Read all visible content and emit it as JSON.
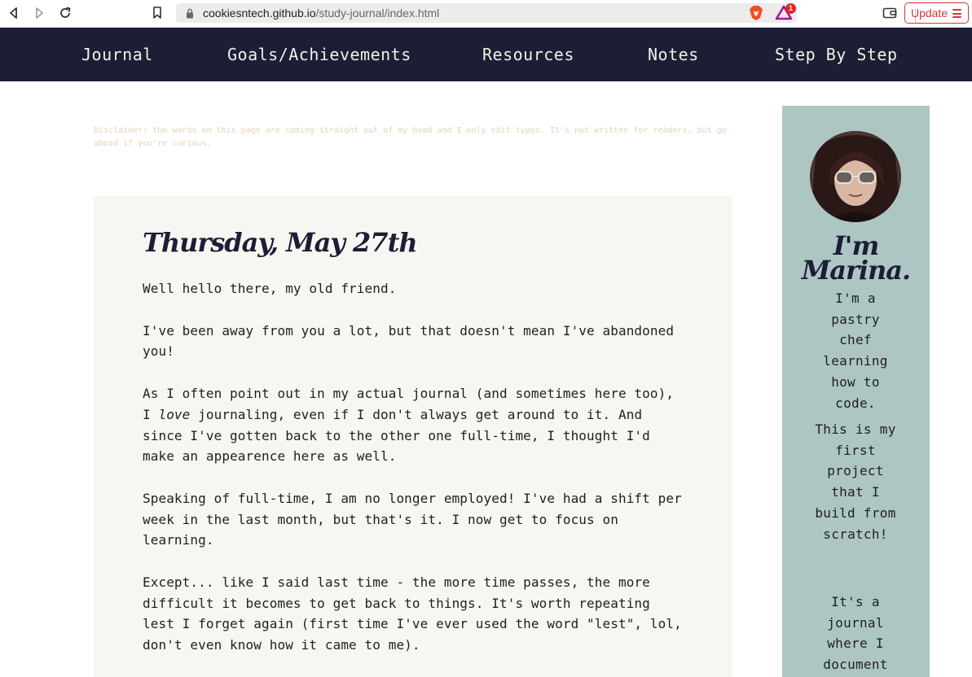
{
  "browser": {
    "url_host": "cookiesntech.github.io",
    "url_path": "/study-journal/index.html",
    "update_label": "Update",
    "notification_count": "1"
  },
  "nav": {
    "links": [
      "Journal",
      "Goals/Achievements",
      "Resources",
      "Notes",
      "Step By Step"
    ]
  },
  "disclaimer": "Disclaimer: the words on this page are coming straight out of my head and I only edit typos. It's not written for readers, but go ahead if you're curious.",
  "entry": {
    "title": "Thursday, May 27th",
    "p1": "Well hello there, my old friend.",
    "p2": "I've been away from you a lot, but that doesn't mean I've abandoned you!",
    "p3_a": "As I often point out in my actual journal (and sometimes here too), I ",
    "p3_em": "love",
    "p3_b": " journaling, even if I don't always get around to it. And since I've gotten back to the other one full-time, I thought I'd make an appearence here as well.",
    "p4": "Speaking of full-time, I am no longer employed! I've had a shift per week in the last month, but that's it. I now get to focus on learning.",
    "p5": "Except... like I said last time - the more time passes, the more difficult it becomes to get back to things. It's worth repeating lest I forget again (first time I've ever used the word \"lest\", lol, don't even know how it came to me)."
  },
  "sidebar": {
    "name": "I'm Marina.",
    "intro": "I'm a pastry chef learning how to code.",
    "project": "This is my first project that I build from scratch!",
    "journal": "It's a journal where I document"
  },
  "colors": {
    "nav_bg": "#1c1e35",
    "nav_text": "#f4f0e8",
    "card_bg": "#f8f6f2",
    "sidebar_bg": "#adc6c4",
    "disclaimer": "#e3d3b6",
    "update_red": "#d3353a"
  }
}
